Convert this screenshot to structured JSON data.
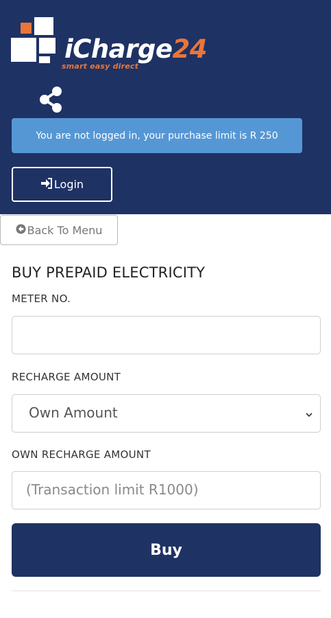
{
  "logo": {
    "brand_white": "iCharge",
    "brand_orange": "24",
    "tagline": "smart easy direct"
  },
  "header": {
    "alert_text": "You are not logged in, your purchase limit is R 250",
    "login_label": "Login"
  },
  "nav": {
    "back_label": "Back To Menu"
  },
  "form": {
    "title": "BUY PREPAID ELECTRICITY",
    "meter_label": "METER NO.",
    "meter_value": "",
    "amount_label": "RECHARGE AMOUNT",
    "amount_selected": "Own Amount",
    "own_amount_label": "OWN RECHARGE AMOUNT",
    "own_amount_placeholder": "(Transaction limit R1000)",
    "buy_label": "Buy"
  },
  "colors": {
    "header_bg": "#1f3264",
    "brand_orange": "#e9753b",
    "alert_bg": "#5597d5",
    "button_bg": "#1f3264"
  },
  "icons": {
    "share": "share-icon",
    "login": "sign-in-icon",
    "back": "arrow-circle-left-icon",
    "dropdown": "chevron-down-icon"
  }
}
